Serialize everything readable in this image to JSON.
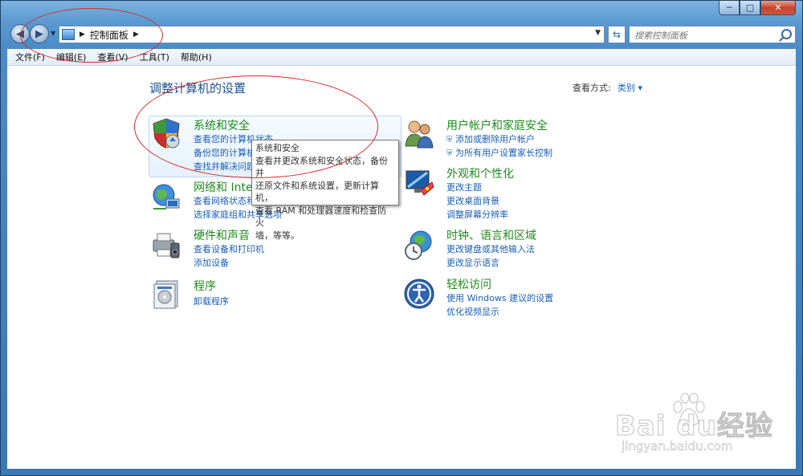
{
  "window": {
    "controls": {
      "minimize": "─",
      "maximize": "□",
      "close": "✕"
    }
  },
  "navbar": {
    "back": "◀",
    "forward": "▶",
    "address_path": "控制面板",
    "address_sep": "▶",
    "search_placeholder": "搜索控制面板",
    "refresh": "⇆"
  },
  "menu": [
    "文件(F)",
    "编辑(E)",
    "查看(V)",
    "工具(T)",
    "帮助(H)"
  ],
  "main": {
    "heading": "调整计算机的设置",
    "view_by_label": "查看方式:",
    "view_by_value": "类别 ▾"
  },
  "categories": [
    {
      "title": "系统和安全",
      "links": [
        "查看您的计算机状态",
        "备份您的计算机",
        "查找并解决问题"
      ]
    },
    {
      "title": "网络和 Internet",
      "links": [
        "查看网络状态和任务",
        "选择家庭组和共享选项"
      ]
    },
    {
      "title": "硬件和声音",
      "links": [
        "查看设备和打印机",
        "添加设备"
      ]
    },
    {
      "title": "程序",
      "links": [
        "卸载程序"
      ]
    },
    {
      "title": "用户帐户和家庭安全",
      "links": [
        "添加或删除用户帐户",
        "为所有用户设置家长控制"
      ]
    },
    {
      "title": "外观和个性化",
      "links": [
        "更改主题",
        "更改桌面背景",
        "调整屏幕分辨率"
      ]
    },
    {
      "title": "时钟、语言和区域",
      "links": [
        "更改键盘或其他输入法",
        "更改显示语言"
      ]
    },
    {
      "title": "轻松访问",
      "links": [
        "使用 Windows 建议的设置",
        "优化视频显示"
      ]
    }
  ],
  "tooltip": {
    "title": "系统和安全",
    "lines": [
      "查看并更改系统和安全状态，备份并",
      "还原文件和系统设置，更新计算机，",
      "查看 RAM 和处理器速度和检查防火",
      "墙，等等。"
    ]
  },
  "watermark": {
    "text": "Bai du经验",
    "url": "jingyan.baidu.com"
  },
  "colors": {
    "title_green": "#1f8a1f",
    "link_blue": "#1a5fb4",
    "annotation_red": "#d42a2a"
  }
}
